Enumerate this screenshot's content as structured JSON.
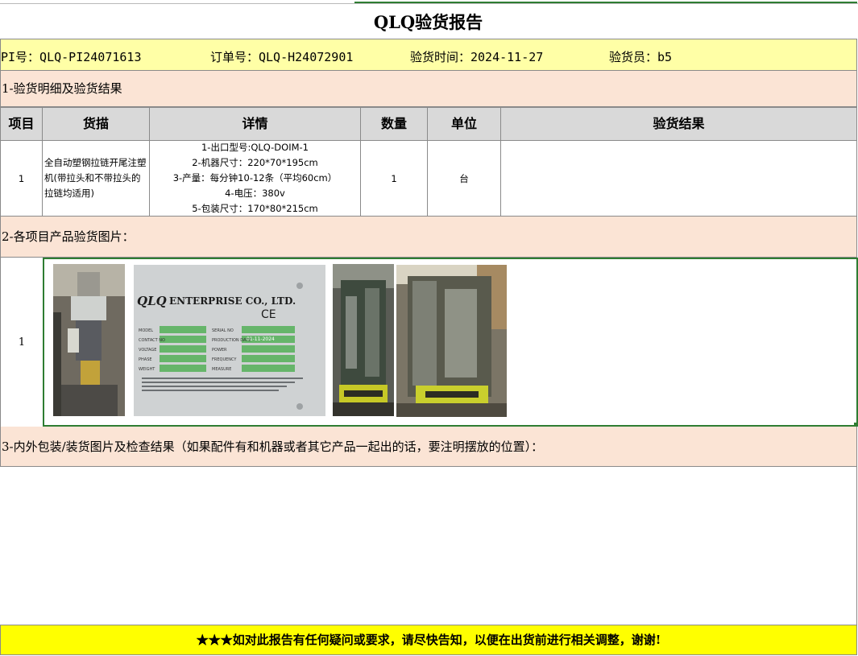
{
  "report": {
    "title": "QLQ验货报告",
    "pi": "PI号：QLQ-PI24071613",
    "order": "订单号：QLQ-H24072901",
    "date": "验货时间：2024-11-27",
    "inspector": "验货员：b5"
  },
  "sections": {
    "s1": "1-验货明细及验货结果",
    "s2": "2-各项目产品验货图片：",
    "s3": "3-内外包装/装货图片及检查结果（如果配件有和机器或者其它产品一起出的话，要注明摆放的位置）："
  },
  "table": {
    "headers": [
      "项目",
      "货描",
      "详情",
      "数量",
      "单位",
      "验货结果"
    ],
    "row": {
      "item": "1",
      "description": "全自动塑钢拉链开尾注塑机(带拉头和不带拉头的拉链均适用)",
      "details": [
        "1-出口型号:QLQ-DOIM-1",
        "2-机器尺寸：220*70*195cm",
        "3-产量：每分钟10-12条（平均60cm）",
        "4-电压：380v",
        "5-包装尺寸：170*80*215cm"
      ],
      "quantity": "1",
      "unit": "台",
      "result": ""
    }
  },
  "photos": {
    "row_number": "1",
    "nameplate": {
      "brand": "QLQ",
      "company": "ENTERPRISE CO., LTD.",
      "ce": "CE",
      "fields_left": [
        "MODEL",
        "CONTACT NO",
        "VOLTAGE",
        "PHASE",
        "WEIGHT"
      ],
      "fields_right": [
        "SERIAL NO",
        "PRODUCTION DATE",
        "POWER",
        "FREQUENCY",
        "MEASURE"
      ],
      "production_date": "01-11-2024",
      "units_left": [
        "",
        "",
        "V",
        "PH",
        "KG"
      ],
      "units_right": [
        "",
        "",
        "KW",
        "HZ",
        "CM"
      ]
    }
  },
  "footer": "★★★如对此报告有任何疑问或要求，请尽快告知，以便在出货前进行相关调整，谢谢!",
  "colors": {
    "info_bg": "#ffffa6",
    "section_bg": "#fbe4d5",
    "header_bg": "#d9d9d9",
    "footer_bg": "#ffff00",
    "selection": "#2e7d32"
  }
}
